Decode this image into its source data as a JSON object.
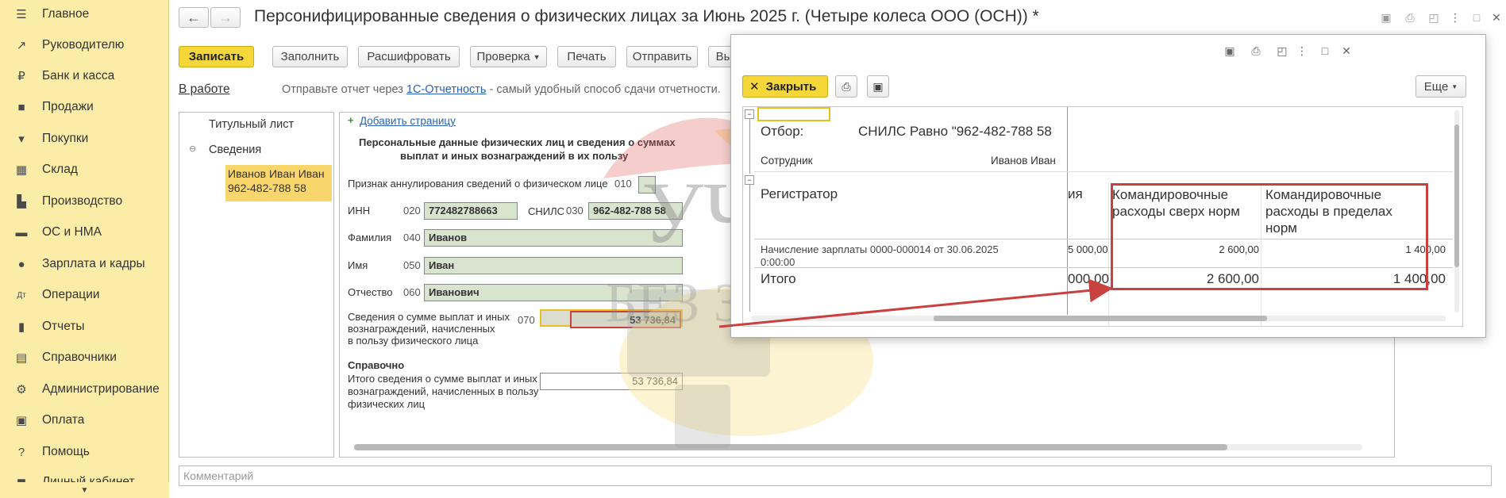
{
  "sidebar": {
    "items": [
      {
        "label": "Главное",
        "icon": "menu-icon"
      },
      {
        "label": "Руководителю",
        "icon": "trend-icon"
      },
      {
        "label": "Банк и касса",
        "icon": "coin-icon"
      },
      {
        "label": "Продажи",
        "icon": "bag-icon"
      },
      {
        "label": "Покупки",
        "icon": "cart-icon"
      },
      {
        "label": "Склад",
        "icon": "warehouse-icon"
      },
      {
        "label": "Производство",
        "icon": "factory-icon"
      },
      {
        "label": "ОС и НМА",
        "icon": "truck-icon"
      },
      {
        "label": "Зарплата и кадры",
        "icon": "person-icon"
      },
      {
        "label": "Операции",
        "icon": "operations-icon"
      },
      {
        "label": "Отчеты",
        "icon": "bar-chart-icon"
      },
      {
        "label": "Справочники",
        "icon": "book-icon"
      },
      {
        "label": "Администрирование",
        "icon": "gear-icon"
      },
      {
        "label": "Оплата",
        "icon": "payment-icon"
      },
      {
        "label": "Помощь",
        "icon": "question-icon"
      },
      {
        "label": "Личный кабинет",
        "icon": "cabinet-icon"
      }
    ]
  },
  "header": {
    "title": "Персонифицированные сведения о физических лицах за Июнь 2025 г. (Четыре колеса ООО (ОСН)) *"
  },
  "toolbar": {
    "save": "Записать",
    "fill": "Заполнить",
    "decode": "Расшифровать",
    "check": "Проверка",
    "print": "Печать",
    "send": "Отправить",
    "more": "Вы"
  },
  "status": {
    "state": "В работе",
    "hint_before": "Отправьте отчет через ",
    "hint_link": "1С-Отчетность",
    "hint_after": " - самый удобный способ сдачи отчетности."
  },
  "tree": {
    "title_page": "Титульный лист",
    "section": "Сведения",
    "person_name": "Иванов Иван Иван",
    "person_snils": "962-482-788 58"
  },
  "form": {
    "add_page": "Добавить страницу",
    "heading_line1": "Персональные данные физических лиц и сведения о суммах",
    "heading_line2": "выплат и иных вознаграждений в их пользу",
    "annul_label": "Признак аннулирования сведений о физическом лице",
    "annul_code": "010",
    "inn_label": "ИНН",
    "inn_code": "020",
    "inn_value": "772482788663",
    "snils_label": "СНИЛС",
    "snils_code": "030",
    "snils_value": "962-482-788 58",
    "last_label": "Фамилия",
    "last_code": "040",
    "last_value": "Иванов",
    "first_label": "Имя",
    "first_code": "050",
    "first_value": "Иван",
    "middle_label": "Отчество",
    "middle_code": "060",
    "middle_value": "Иванович",
    "sum_label_1": "Сведения о сумме выплат и иных",
    "sum_label_2": "вознаграждений, начисленных",
    "sum_label_3": "в пользу физического лица",
    "sum_code": "070",
    "sum_value": "53 736,84",
    "ref_title": "Справочно",
    "total_label_1": "Итого сведения о сумме выплат и иных",
    "total_label_2": "вознаграждений, начисленных в пользу",
    "total_label_3": "физических лиц",
    "total_value": "53 736,84"
  },
  "comment_placeholder": "Комментарий",
  "watermark": {
    "line1": "УЧЕТ",
    "line2": "БЕЗ ЗАБОТ"
  },
  "report": {
    "close": "Закрыть",
    "more": "Еще",
    "filter_label": "Отбор:",
    "filter_value": "СНИЛС Равно \"962-482-788 58",
    "employee_label": "Сотрудник",
    "employee_value": "Иванов Иван",
    "col_registrar": "Регистратор",
    "col_partial": "ия",
    "col_over_1": "Командировочные",
    "col_over_2": "расходы сверх норм",
    "col_within_1": "Командировочные",
    "col_within_2": "расходы в пределах",
    "col_within_3": "норм",
    "row_doc_1": "Начисление зарплаты 0000-000014 от 30.06.2025",
    "row_doc_2": "0:00:00",
    "row_partial": "5 000,00",
    "row_over": "2 600,00",
    "row_within": "1 400,00",
    "total_label": "Итого",
    "total_partial": "000,00",
    "total_over": "2 600,00",
    "total_within": "1 400,00"
  },
  "colors": {
    "accent": "#f5d73a",
    "sidebar": "#fbeda8",
    "highlight": "#c9413f",
    "field": "#d9e4cf"
  }
}
